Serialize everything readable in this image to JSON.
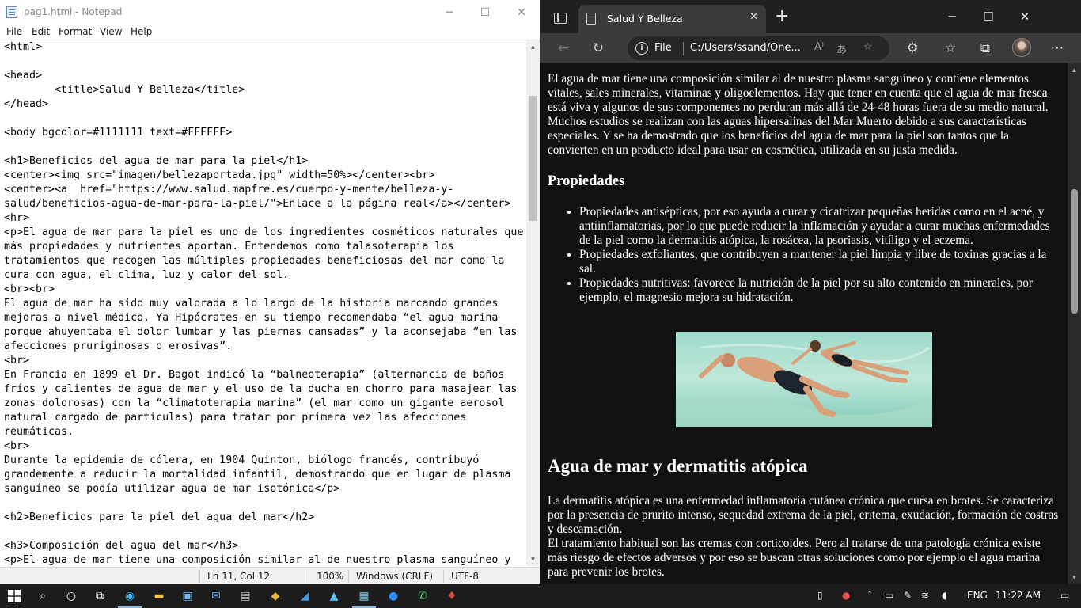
{
  "notepad": {
    "title": "pag1.html - Notepad",
    "controls": {
      "minimize": "─",
      "maximize": "☐",
      "close": "✕"
    },
    "menu": [
      "File",
      "Edit",
      "Format",
      "View",
      "Help"
    ],
    "lines": [
      "<html>",
      "",
      "<head>",
      "        <title>Salud Y Belleza</title>",
      "</head>",
      "",
      "<body bgcolor=#1111111 text=#FFFFFF>",
      "",
      "<h1>Beneficios del agua de mar para la piel</h1>",
      "<center><img src=\"imagen/bellezaportada.jpg\" width=50%></center><br>",
      "<center><a  href=\"https://www.salud.mapfre.es/cuerpo-y-mente/belleza-y-",
      "salud/beneficios-agua-de-mar-para-la-piel/\">Enlace a la página real</a></center>",
      "<hr>",
      "<p>El agua de mar para la piel es uno de los ingredientes cosméticos naturales que",
      "más propiedades y nutrientes aportan. Entendemos como talasoterapia los",
      "tratamientos que recogen las múltiples propiedades beneficiosas del mar como la",
      "cura con agua, el clima, luz y calor del sol.",
      "<br><br>",
      "El agua de mar ha sido muy valorada a lo largo de la historia marcando grandes",
      "mejoras a nivel médico. Ya Hipócrates en su tiempo recomendaba “el agua marina",
      "porque ahuyentaba el dolor lumbar y las piernas cansadas” y la aconsejaba “en las",
      "afecciones pruriginosas o erosivas”.",
      "<br>",
      "En Francia en 1899 el Dr. Bagot indicó la “balneoterapia” (alternancia de baños",
      "fríos y calientes de agua de mar y el uso de la ducha en chorro para masajear las",
      "zonas dolorosas) con la “climatoterapia marina” (el mar como un gigante aerosol",
      "natural cargado de partículas) para tratar por primera vez las afecciones",
      "reumáticas.",
      "<br>",
      "Durante la epidemia de cólera, en 1904 Quinton, biólogo francés, contribuyó",
      "grandemente a reducir la mortalidad infantil, demostrando que en lugar de plasma",
      "sanguíneo se podía utilizar agua de mar isotónica</p>",
      "",
      "<h2>Beneficios para la piel del agua del mar</h2>",
      "",
      "<h3>Composición del agua del mar</h3>",
      "<p>El agua de mar tiene una composición similar al de nuestro plasma sanguíneo y"
    ],
    "status": {
      "position": "Ln 11, Col 12",
      "zoom": "100%",
      "eol": "Windows (CRLF)",
      "encoding": "UTF-8"
    }
  },
  "browser": {
    "tab_title": "Salud Y Belleza",
    "tab_close": "✕",
    "new_tab": "+",
    "controls": {
      "minimize": "─",
      "maximize": "☐",
      "close": "✕"
    },
    "address": {
      "scheme": "File",
      "url": "C:/Users/ssand/One..."
    },
    "page": {
      "para1": "El agua de mar tiene una composición similar al de nuestro plasma sanguíneo y contiene elementos vitales, sales minerales, vitaminas y oligoelementos. Hay que tener en cuenta que el agua de mar fresca está viva y algunos de sus componentes no perduran más allá de 24-48 horas fuera de su medio natural. Muchos estudios se realizan con las aguas hipersalinas del Mar Muerto debido a sus características especiales. Y se ha demostrado que los beneficios del agua de mar para la piel son tantos que la convierten en un producto ideal para usar en cosmética, utilizada en su justa medida.",
      "h3": "Propiedades",
      "list": [
        "Propiedades antisépticas, por eso ayuda a curar y cicatrizar pequeñas heridas como en el acné, y antiinflamatorias, por lo que puede reducir la inflamación y ayudar a curar muchas enfermedades de la piel como la dermatitis atópica, la rosácea, la psoriasis, vitíligo y el eczema.",
        "Propiedades exfoliantes, que contribuyen a mantener la piel limpia y libre de toxinas gracias a la sal.",
        "Propiedades nutritivas: favorece la nutrición de la piel por su alto contenido en minerales, por ejemplo, el magnesio mejora su hidratación."
      ],
      "h2": "Agua de mar y dermatitis atópica",
      "para2a": "La dermatitis atópica es una enfermedad inflamatoria cutánea crónica que cursa en brotes. Se caracteriza por la presencia de prurito intenso, sequedad extrema de la piel, eritema, exudación, formación de costras y descamación.",
      "para2b": "El tratamiento habitual son las cremas con corticoides. Pero al tratarse de una patología crónica existe más riesgo de efectos adversos y por eso se buscan otras soluciones como por ejemplo el agua marina para prevenir los brotes."
    }
  },
  "taskbar": {
    "language": "ENG",
    "time": "11:22 AM"
  },
  "colors": {
    "page_bg": "#111111",
    "page_text": "#FFFFFF",
    "edge_chrome": "#3b3b3b",
    "taskbar": "#1c1c1c"
  }
}
